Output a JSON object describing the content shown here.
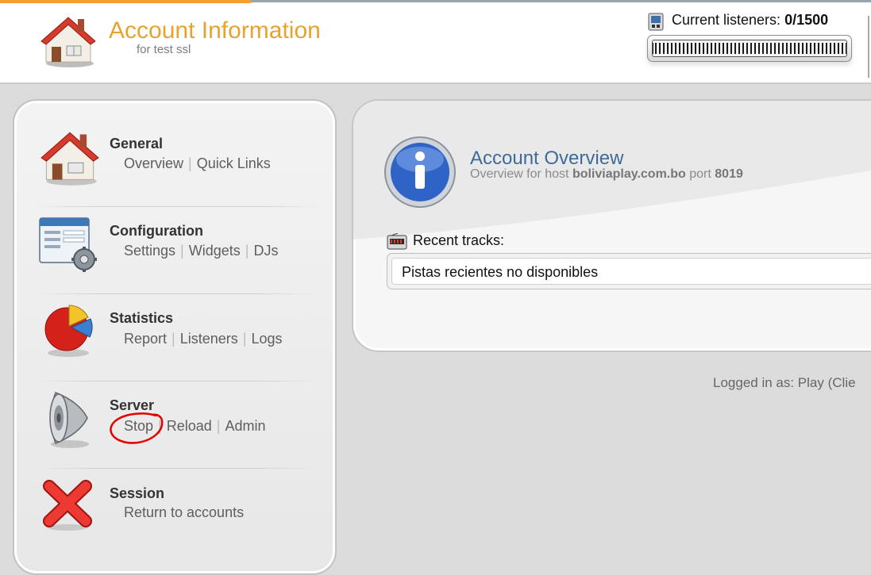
{
  "header": {
    "title": "Account Information",
    "subtitle": "for test ssl",
    "icon": "house-icon",
    "listeners_label": "Current listeners:",
    "listeners_count": "0/1500",
    "listeners_fraction": 0
  },
  "sidebar": {
    "sections": [
      {
        "title": "General",
        "icon": "house-icon",
        "links": [
          "Overview",
          "Quick Links"
        ]
      },
      {
        "title": "Configuration",
        "icon": "config-window-gear-icon",
        "links": [
          "Settings",
          "Widgets",
          "DJs"
        ]
      },
      {
        "title": "Statistics",
        "icon": "pie-chart-icon",
        "links": [
          "Report",
          "Listeners",
          "Logs"
        ]
      },
      {
        "title": "Server",
        "icon": "speaker-icon",
        "links": [
          "Stop",
          "Reload",
          "Admin"
        ]
      },
      {
        "title": "Session",
        "icon": "red-x-icon",
        "links": [
          "Return to accounts"
        ]
      }
    ]
  },
  "main": {
    "title": "Account Overview",
    "subtitle_prefix": "Overview for host",
    "host": "boliviaplay.com.bo",
    "port_label": "port",
    "port": "8019",
    "recent_tracks_label": "Recent tracks:",
    "recent_tracks_value": "Pistas recientes no disponibles"
  },
  "footer": {
    "logged_in": "Logged in as: Play (Clie"
  },
  "colors": {
    "title_orange": "#e8a32b",
    "overview_blue": "#3f6b9a",
    "annotation_red": "#e00000"
  }
}
